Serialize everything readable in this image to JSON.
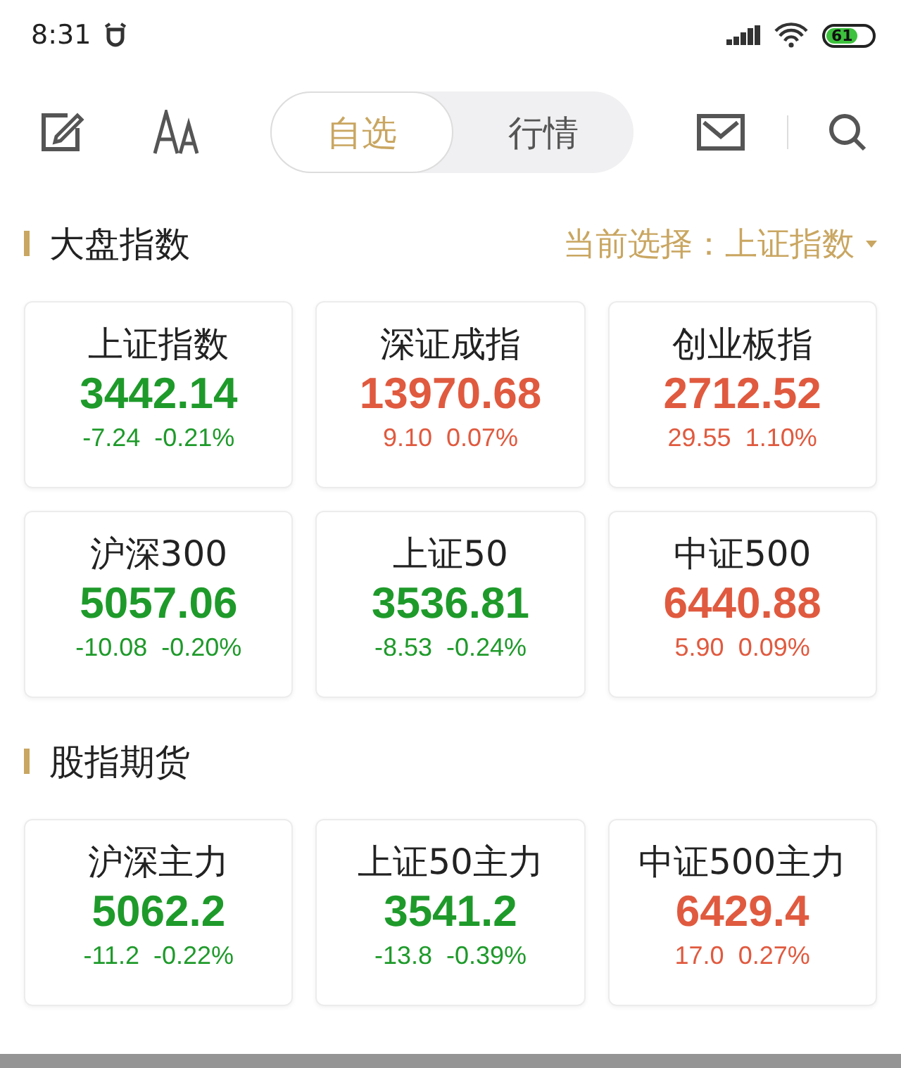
{
  "status_bar": {
    "time": "8:31",
    "battery": "61"
  },
  "toolbar": {
    "tabs": [
      {
        "label": "自选",
        "selected": true
      },
      {
        "label": "行情",
        "selected": false
      }
    ]
  },
  "sections": [
    {
      "title": "大盘指数",
      "selector": {
        "label": "当前选择：",
        "value": "上证指数"
      },
      "cards": [
        {
          "name": "上证指数",
          "value": "3442.14",
          "change": "-7.24",
          "percent": "-0.21%",
          "color": "#1e9a2a"
        },
        {
          "name": "深证成指",
          "value": "13970.68",
          "change": "9.10",
          "percent": "0.07%",
          "color": "#e05a3f"
        },
        {
          "name": "创业板指",
          "value": "2712.52",
          "change": "29.55",
          "percent": "1.10%",
          "color": "#e05a3f"
        },
        {
          "name": "沪深300",
          "value": "5057.06",
          "change": "-10.08",
          "percent": "-0.20%",
          "color": "#1e9a2a"
        },
        {
          "name": "上证50",
          "value": "3536.81",
          "change": "-8.53",
          "percent": "-0.24%",
          "color": "#1e9a2a"
        },
        {
          "name": "中证500",
          "value": "6440.88",
          "change": "5.90",
          "percent": "0.09%",
          "color": "#e05a3f"
        }
      ]
    },
    {
      "title": "股指期货",
      "cards": [
        {
          "name": "沪深主力",
          "value": "5062.2",
          "change": "-11.2",
          "percent": "-0.22%",
          "color": "#1e9a2a"
        },
        {
          "name": "上证50主力",
          "value": "3541.2",
          "change": "-13.8",
          "percent": "-0.39%",
          "color": "#1e9a2a"
        },
        {
          "name": "中证500主力",
          "value": "6429.4",
          "change": "17.0",
          "percent": "0.27%",
          "color": "#e05a3f"
        }
      ]
    }
  ]
}
